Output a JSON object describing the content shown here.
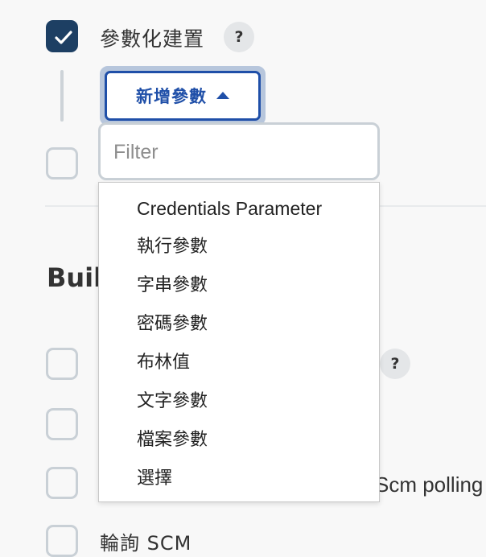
{
  "param_option": {
    "label": "參數化建置",
    "checked": true,
    "help_icon": "question-mark-icon",
    "help_text": "?"
  },
  "add_param_button": {
    "label": "新增參數",
    "icon": "caret-up-icon"
  },
  "filter": {
    "placeholder": "Filter",
    "value": ""
  },
  "param_menu": {
    "items": [
      {
        "label": "Credentials Parameter"
      },
      {
        "label": "執行參數"
      },
      {
        "label": "字串參數"
      },
      {
        "label": "密碼參數"
      },
      {
        "label": "布林值"
      },
      {
        "label": "文字參數"
      },
      {
        "label": "檔案參數"
      },
      {
        "label": "選擇"
      }
    ]
  },
  "build_section": {
    "title_visible": "Buil",
    "help_text": "?",
    "scm_polling_fragment": "Scm polling",
    "bottom_fragment": "輪詢 SCM"
  },
  "colors": {
    "accent": "#1f4fa8",
    "checked_box": "#1d3f63",
    "border": "#c9d0d6"
  }
}
